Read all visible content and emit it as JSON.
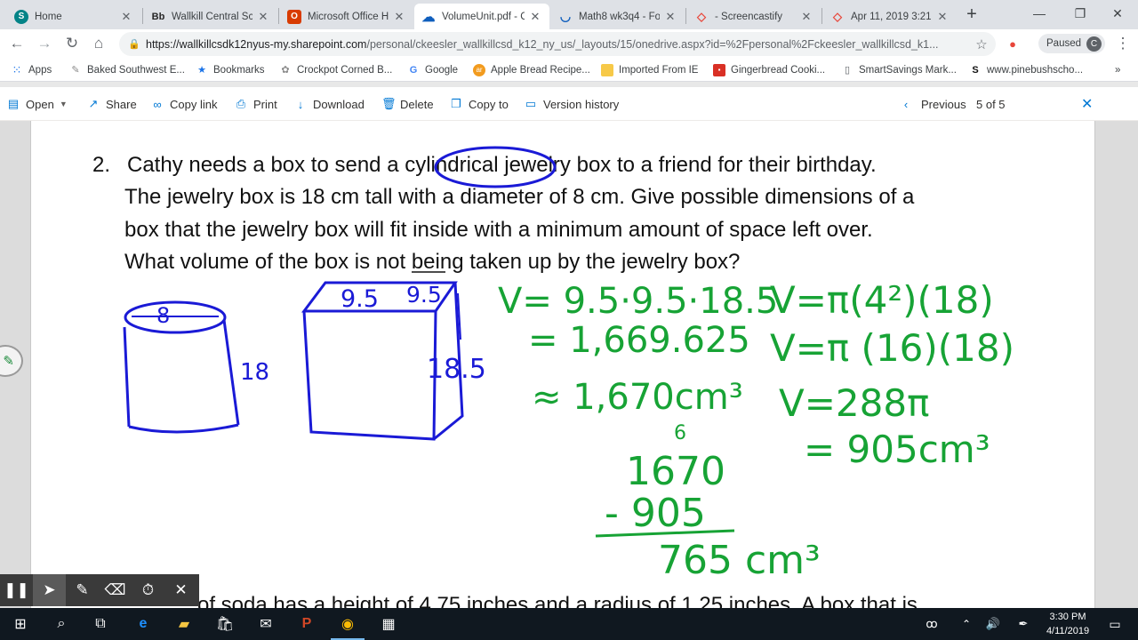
{
  "browser": {
    "tabs": [
      {
        "title": "Home",
        "icon": "sharepoint-icon",
        "color": "#038387",
        "glyph": "S",
        "active": false
      },
      {
        "title": "Wallkill Central Sc",
        "icon": "blackboard-icon",
        "color": "#262626",
        "glyph": "Bb",
        "active": false
      },
      {
        "title": "Microsoft Office H",
        "icon": "office-icon",
        "color": "#d83b01",
        "glyph": "O",
        "active": false
      },
      {
        "title": "VolumeUnit.pdf - C",
        "icon": "onedrive-icon",
        "color": "#0f5ebd",
        "glyph": "☁",
        "active": true
      },
      {
        "title": "Math8 wk3q4 - Fo",
        "icon": "forms-icon",
        "color": "#ffffff",
        "glyph": "◡",
        "active": false
      },
      {
        "title": "- Screencastify",
        "icon": "screencastify-icon",
        "color": "#ffffff",
        "glyph": "◇",
        "active": false
      },
      {
        "title": "Apr 11, 2019 3:21",
        "icon": "screencastify-icon",
        "color": "#ffffff",
        "glyph": "◇",
        "active": false
      }
    ],
    "new_tab_label": "+",
    "url_host": "https://wallkillcsdk12nyus-my.sharepoint.com",
    "url_path": "/personal/ckeesler_wallkillcsd_k12_ny_us/_layouts/15/onedrive.aspx?id=%2Fpersonal%2Fckeesler_wallkillcsd_k1...",
    "profile_status": "Paused",
    "profile_initial": "C",
    "bookmarks": [
      {
        "label": "Apps",
        "icon": "apps-grid-icon"
      },
      {
        "label": "Baked Southwest E...",
        "icon": "recipe-icon"
      },
      {
        "label": "Bookmarks",
        "icon": "star-icon"
      },
      {
        "label": "Crockpot Corned B...",
        "icon": "recipe-icon"
      },
      {
        "label": "Google",
        "icon": "google-icon"
      },
      {
        "label": "Apple Bread Recipe...",
        "icon": "recipe-icon"
      },
      {
        "label": "Imported From IE",
        "icon": "folder-icon"
      },
      {
        "label": "Gingerbread Cooki...",
        "icon": "recipe-icon"
      },
      {
        "label": "SmartSavings Mark...",
        "icon": "page-icon"
      },
      {
        "label": "www.pinebushscho...",
        "icon": "link-icon"
      }
    ],
    "bookmarks_overflow": "»"
  },
  "commandbar": {
    "open": "Open",
    "share": "Share",
    "copy_link": "Copy link",
    "print": "Print",
    "download": "Download",
    "delete": "Delete",
    "copy_to": "Copy to",
    "version_history": "Version history",
    "previous": "Previous",
    "page_counter": "5 of 5"
  },
  "document": {
    "question_number": "2.",
    "lines": [
      "Cathy needs a box to send a cylindrical jewelry box to a friend for their birthday.",
      "The jewelry box is 18 cm tall with a diameter of 8 cm. Give possible dimensions of a",
      "box that the jewelry box will fit inside with a minimum amount of space left over.",
      "What volume of the box is not being taken up by the jewelry box?"
    ],
    "next_question_partial": "of soda has a height of 4.75 inches and a radius of 1.25 inches. A box that is"
  },
  "annotations": {
    "cylinder_diameter": "8",
    "cylinder_height": "18",
    "box_top_1": "9.5",
    "box_top_2": "9.5",
    "box_height": "18.5",
    "work_box_1": "V= 9.5·9.5·18.5",
    "work_box_2": "= 1,669.625",
    "work_box_3": "≈ 1,670cm³",
    "work_cyl_1": "V=π(4²)(18)",
    "work_cyl_2": "V=π (16)(18)",
    "work_cyl_3": "V=288π",
    "work_cyl_4": "= 905cm³",
    "sub_top": "1670",
    "sub_carry": "6",
    "sub_minus": "- 905",
    "sub_result": "765 cm³",
    "ink_green": "#17a335",
    "ink_blue": "#1a1ad6"
  },
  "taskbar": {
    "time": "3:30 PM",
    "date": "4/11/2019"
  }
}
